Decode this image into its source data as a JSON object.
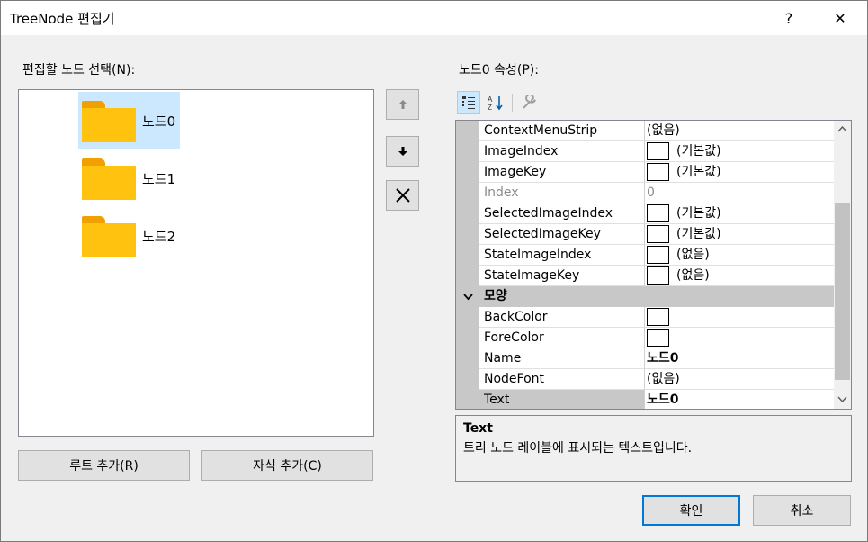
{
  "window": {
    "title": "TreeNode 편집기",
    "help_label": "?",
    "close_label": "✕"
  },
  "left": {
    "label": "편집할 노드 선택(N):",
    "nodes": [
      {
        "label": "노드0",
        "selected": true
      },
      {
        "label": "노드1",
        "selected": false
      },
      {
        "label": "노드2",
        "selected": false
      }
    ],
    "add_root_label": "루트 추가(R)",
    "add_child_label": "자식 추가(C)"
  },
  "side_buttons": {
    "up_icon": "arrow-up-icon",
    "down_icon": "arrow-down-icon",
    "delete_icon": "delete-x-icon"
  },
  "right": {
    "label": "노드0 속성(P):",
    "toolbar": [
      "categorized-icon",
      "alphabetical-icon",
      "property-pages-icon"
    ],
    "rows": [
      {
        "name": "ContextMenuStrip",
        "value": "(없음)",
        "swatch": false
      },
      {
        "name": "ImageIndex",
        "value": "(기본값)",
        "swatch": true
      },
      {
        "name": "ImageKey",
        "value": "(기본값)",
        "swatch": true
      },
      {
        "name": "Index",
        "value": "0",
        "swatch": false,
        "disabled": true
      },
      {
        "name": "SelectedImageIndex",
        "value": "(기본값)",
        "swatch": true
      },
      {
        "name": "SelectedImageKey",
        "value": "(기본값)",
        "swatch": true
      },
      {
        "name": "StateImageIndex",
        "value": "(없음)",
        "swatch": true
      },
      {
        "name": "StateImageKey",
        "value": "(없음)",
        "swatch": true
      }
    ],
    "category": "모양",
    "rows2": [
      {
        "name": "BackColor",
        "value": "",
        "swatch": true
      },
      {
        "name": "ForeColor",
        "value": "",
        "swatch": true
      },
      {
        "name": "Name",
        "value": "노드0",
        "swatch": false,
        "bold": true
      },
      {
        "name": "NodeFont",
        "value": "(없음)",
        "swatch": false
      },
      {
        "name": "Text",
        "value": "노드0",
        "swatch": false,
        "bold": true,
        "selected": true
      }
    ],
    "description_title": "Text",
    "description_text": "트리 노드 레이블에 표시되는 텍스트입니다."
  },
  "footer": {
    "ok_label": "확인",
    "cancel_label": "취소"
  },
  "colors": {
    "accent": "#0078d7",
    "selection": "#cce8ff",
    "folder": "#ffc20e"
  }
}
